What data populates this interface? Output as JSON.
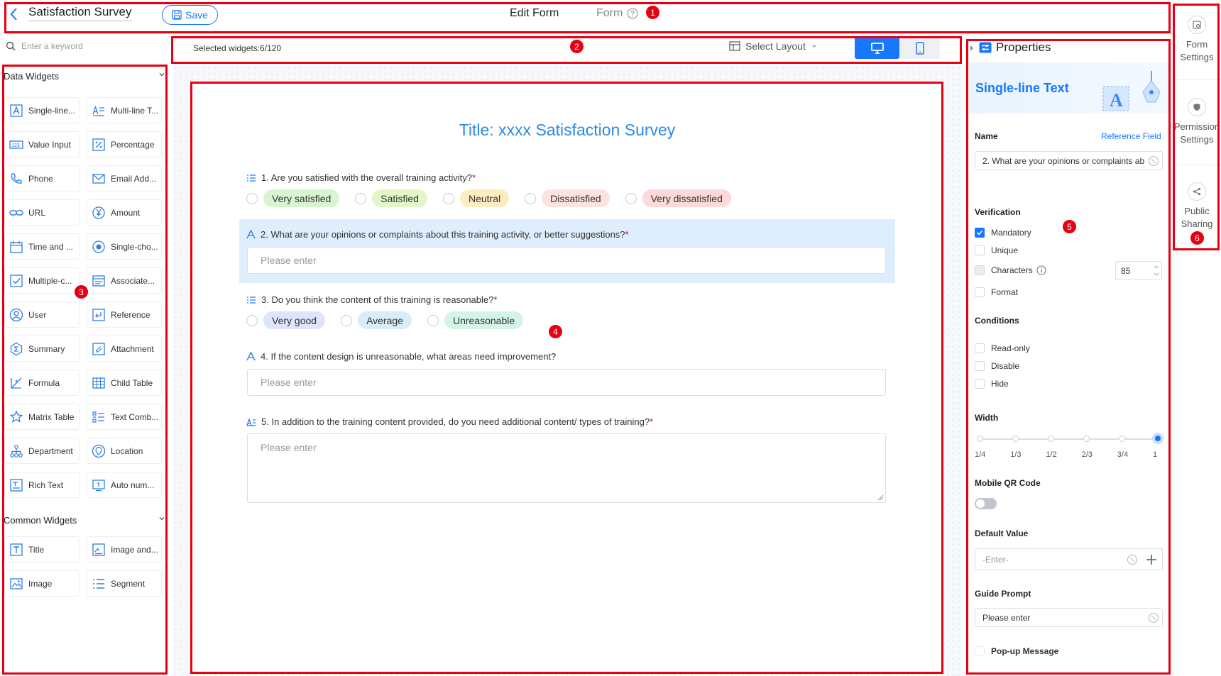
{
  "header": {
    "title": "Satisfaction Survey",
    "save_label": "Save",
    "tabs": [
      "Edit Form",
      "Form"
    ]
  },
  "badges": [
    "1",
    "2",
    "3",
    "4",
    "5",
    "6"
  ],
  "left_panel": {
    "search_placeholder": "Enter a keyword",
    "data_widgets_title": "Data Widgets",
    "data_widgets": [
      {
        "label": "Single-line...",
        "icon": "text-a-icon"
      },
      {
        "label": "Multi-line T...",
        "icon": "multiline-icon"
      },
      {
        "label": "Value Input",
        "icon": "number-icon"
      },
      {
        "label": "Percentage",
        "icon": "percent-icon"
      },
      {
        "label": "Phone",
        "icon": "phone-icon"
      },
      {
        "label": "Email Add...",
        "icon": "email-icon"
      },
      {
        "label": "URL",
        "icon": "link-icon"
      },
      {
        "label": "Amount",
        "icon": "yen-icon"
      },
      {
        "label": "Time and ...",
        "icon": "calendar-icon"
      },
      {
        "label": "Single-cho...",
        "icon": "radio-icon"
      },
      {
        "label": "Multiple-c...",
        "icon": "checkbox-icon"
      },
      {
        "label": "Associate...",
        "icon": "associate-icon"
      },
      {
        "label": "User",
        "icon": "user-icon"
      },
      {
        "label": "Reference",
        "icon": "reference-icon"
      },
      {
        "label": "Summary",
        "icon": "summary-icon"
      },
      {
        "label": "Attachment",
        "icon": "attachment-icon"
      },
      {
        "label": "Formula",
        "icon": "formula-icon"
      },
      {
        "label": "Child Table",
        "icon": "table-icon"
      },
      {
        "label": "Matrix Table",
        "icon": "matrix-icon"
      },
      {
        "label": "Text Comb...",
        "icon": "text-comb-icon"
      },
      {
        "label": "Department",
        "icon": "department-icon"
      },
      {
        "label": "Location",
        "icon": "location-icon"
      },
      {
        "label": "Rich Text",
        "icon": "rich-text-icon"
      },
      {
        "label": "Auto num...",
        "icon": "auto-number-icon"
      }
    ],
    "common_widgets_title": "Common Widgets",
    "common_widgets": [
      {
        "label": "Title",
        "icon": "title-icon"
      },
      {
        "label": "Image and...",
        "icon": "image-text-icon"
      },
      {
        "label": "Image",
        "icon": "image-icon"
      },
      {
        "label": "Segment",
        "icon": "segment-icon"
      }
    ]
  },
  "toolbar": {
    "selected_widgets": "Selected widgets:6/120",
    "select_layout": "Select Layout"
  },
  "form": {
    "title": "Title: xxxx Satisfaction Survey",
    "questions": [
      {
        "label": "1. Are you satisfied with the overall training activity?",
        "required": "*",
        "options": [
          "Very satisfied",
          "Satisfied",
          "Neutral",
          "Dissatisfied",
          "Very dissatisfied"
        ]
      },
      {
        "label": "2. What are your opinions or complaints about this training activity, or better suggestions?",
        "required": "*",
        "placeholder": "Please enter"
      },
      {
        "label": "3. Do you think the content of this training is reasonable?",
        "required": "*",
        "options": [
          "Very good",
          "Average",
          "Unreasonable"
        ]
      },
      {
        "label": "4. If the content design is unreasonable, what areas need improvement?",
        "placeholder": "Please enter"
      },
      {
        "label": "5. In addition to the training content provided, do you need additional content/ types of training?",
        "required": "*",
        "placeholder": "Please enter"
      }
    ],
    "chip_colors": [
      "#d7f5d0",
      "#e3f6c8",
      "#fdecc2",
      "#fde2de",
      "#fdd9d9",
      "#dde4fb",
      "#d8edf9",
      "#d3f5e6"
    ]
  },
  "properties": {
    "title": "Properties",
    "widget_type": "Single-line Text",
    "name_label": "Name",
    "reference_field": "Reference Field",
    "name_value": "2. What are your opinions or complaints ab",
    "verification_label": "Verification",
    "verification": {
      "mandatory": "Mandatory",
      "unique": "Unique",
      "characters": "Characters",
      "characters_value": "85",
      "format": "Format"
    },
    "conditions_label": "Conditions",
    "conditions": [
      "Read-only",
      "Disable",
      "Hide"
    ],
    "width_label": "Width",
    "width_ticks": [
      "1/4",
      "1/3",
      "1/2",
      "2/3",
      "3/4",
      "1"
    ],
    "width_selected_fraction": 1,
    "mobile_qr_label": "Mobile QR Code",
    "mobile_qr_enabled": false,
    "default_value_label": "Default Value",
    "default_value_placeholder": "-Enter-",
    "guide_prompt_label": "Guide Prompt",
    "guide_prompt_value": "Please enter",
    "popup_message": "Pop-up Message"
  },
  "right_rail": {
    "form_settings": "Form Settings",
    "permission_settings": "Permission Settings",
    "public_sharing": "Public Sharing"
  },
  "colors": {
    "accent": "#1677ff",
    "annotation_red": "#e60012",
    "title_blue": "#2d8ae6"
  }
}
